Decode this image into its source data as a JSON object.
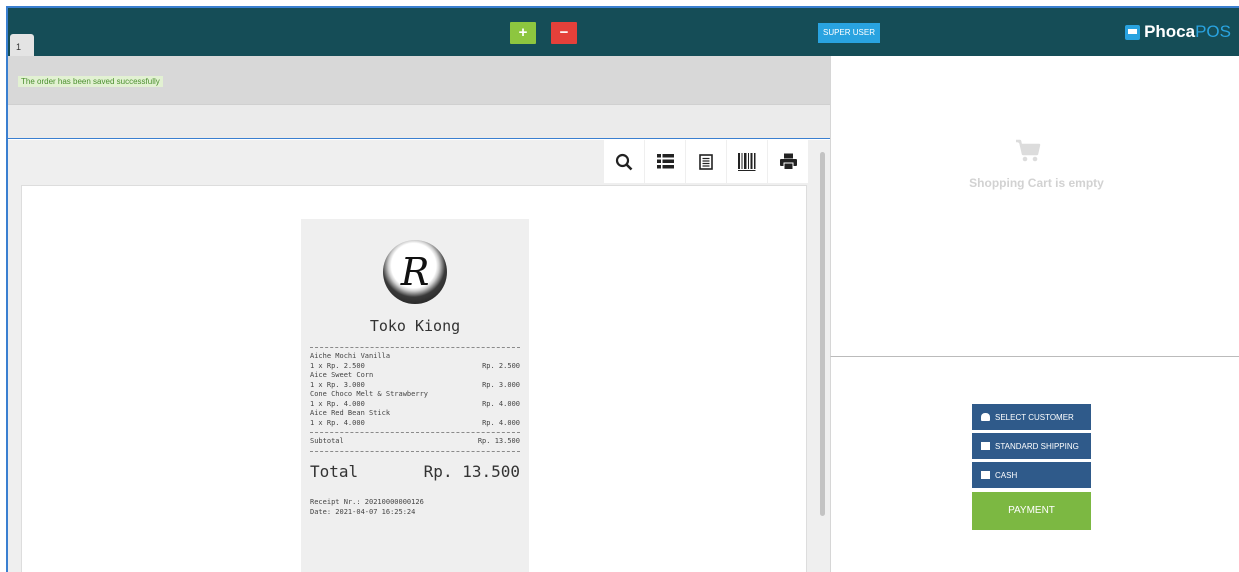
{
  "header": {
    "tab_label": "1",
    "add_label": "+",
    "remove_label": "−",
    "super_user_label": "SUPER USER",
    "logo_part1": "Phoca",
    "logo_part2": "POS"
  },
  "message": "The order has been saved successfully",
  "toolbar_icons": [
    "search-icon",
    "list-icon",
    "receipt-icon",
    "barcode-icon",
    "print-icon"
  ],
  "receipt": {
    "logo_letter": "R",
    "store_name": "Toko Kiong",
    "items": [
      {
        "name": "Aiche Mochi Vanilla",
        "qty_price": "1 x Rp. 2.500",
        "amount": "Rp. 2.500"
      },
      {
        "name": "Aice Sweet Corn",
        "qty_price": "1 x Rp. 3.000",
        "amount": "Rp. 3.000"
      },
      {
        "name": "Cone Choco Melt & Strawberry",
        "qty_price": "1 x Rp. 4.000",
        "amount": "Rp. 4.000"
      },
      {
        "name": "Aice Red Bean Stick",
        "qty_price": "1 x Rp. 4.000",
        "amount": "Rp. 4.000"
      }
    ],
    "subtotal_label": "Subtotal",
    "subtotal_value": "Rp. 13.500",
    "total_label": "Total",
    "total_value": "Rp. 13.500",
    "receipt_nr": "Receipt Nr.: 20210000000126",
    "date": "Date: 2021-04-07 16:25:24"
  },
  "cart": {
    "empty_text": "Shopping Cart is empty"
  },
  "actions": {
    "select_customer": "SELECT CUSTOMER",
    "standard_shipping": "STANDARD SHIPPING",
    "cash": "CASH",
    "payment": "PAYMENT"
  },
  "colors": {
    "topbar": "#154d57",
    "accent_blue": "#29a3e0",
    "add_green": "#8dc63f",
    "remove_red": "#e5403a",
    "action_blue": "#2f5a8a",
    "payment_green": "#7cb842"
  }
}
